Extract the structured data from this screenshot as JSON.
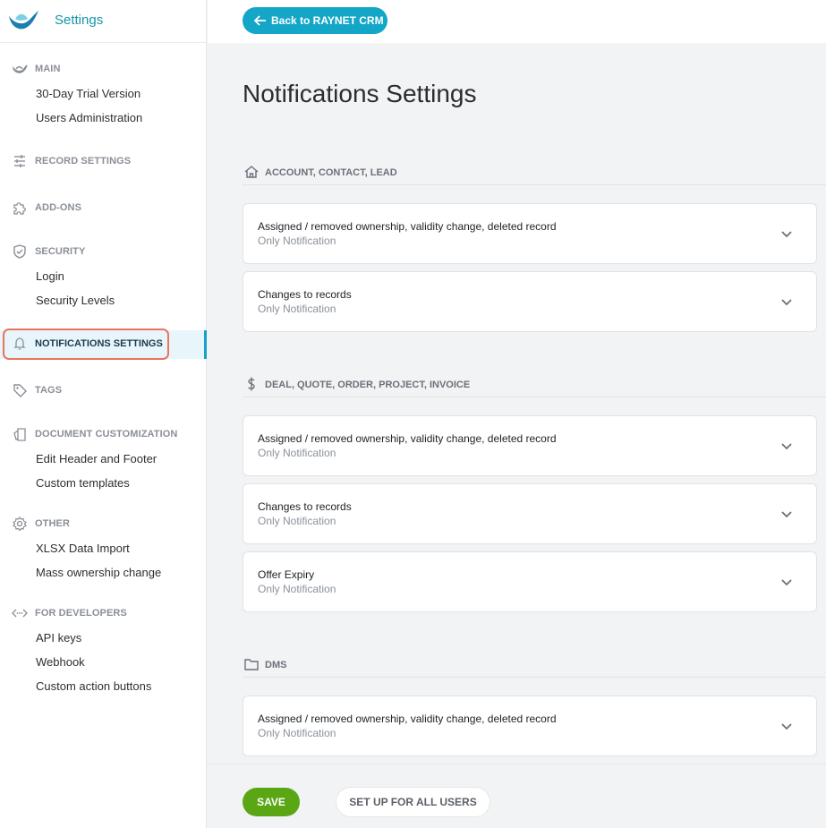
{
  "app": {
    "title": "Settings",
    "logo_icon": "raynet-bird-logo"
  },
  "topbar": {
    "back_label": "Back to RAYNET CRM"
  },
  "colors": {
    "accent": "#14a6c7",
    "save": "#5aa614",
    "highlight": "#e8755e"
  },
  "sidebar": {
    "sections": [
      {
        "label": "MAIN",
        "icon": "bird-icon",
        "items": [
          "30-Day Trial Version",
          "Users Administration"
        ]
      },
      {
        "label": "RECORD SETTINGS",
        "icon": "sliders-icon",
        "items": []
      },
      {
        "label": "ADD-ONS",
        "icon": "puzzle-icon",
        "items": []
      },
      {
        "label": "SECURITY",
        "icon": "shield-icon",
        "items": [
          "Login",
          "Security Levels"
        ]
      },
      {
        "label": "NOTIFICATIONS SETTINGS",
        "icon": "bell-icon",
        "items": [],
        "active": true
      },
      {
        "label": "TAGS",
        "icon": "tag-icon",
        "items": []
      },
      {
        "label": "DOCUMENT CUSTOMIZATION",
        "icon": "document-icon",
        "items": [
          "Edit Header and Footer",
          "Custom templates"
        ]
      },
      {
        "label": "OTHER",
        "icon": "gear-icon",
        "items": [
          "XLSX Data Import",
          "Mass ownership change"
        ]
      },
      {
        "label": "FOR DEVELOPERS",
        "icon": "code-icon",
        "items": [
          "API keys",
          "Webhook",
          "Custom action buttons"
        ]
      }
    ]
  },
  "main": {
    "title": "Notifications Settings",
    "groups": [
      {
        "label": "ACCOUNT, CONTACT, LEAD",
        "icon": "home-icon",
        "cards": [
          {
            "title": "Assigned / removed ownership, validity change, deleted record",
            "subtitle": "Only Notification"
          },
          {
            "title": "Changes to records",
            "subtitle": "Only Notification"
          }
        ]
      },
      {
        "label": "DEAL, QUOTE, ORDER, PROJECT, INVOICE",
        "icon": "dollar-icon",
        "cards": [
          {
            "title": "Assigned / removed ownership, validity change, deleted record",
            "subtitle": "Only Notification"
          },
          {
            "title": "Changes to records",
            "subtitle": "Only Notification"
          },
          {
            "title": "Offer Expiry",
            "subtitle": "Only Notification"
          }
        ]
      },
      {
        "label": "DMS",
        "icon": "folder-icon",
        "cards": [
          {
            "title": "Assigned / removed ownership, validity change, deleted record",
            "subtitle": "Only Notification"
          }
        ]
      }
    ]
  },
  "footer": {
    "save_label": "SAVE",
    "setup_label": "SET UP FOR ALL USERS"
  }
}
